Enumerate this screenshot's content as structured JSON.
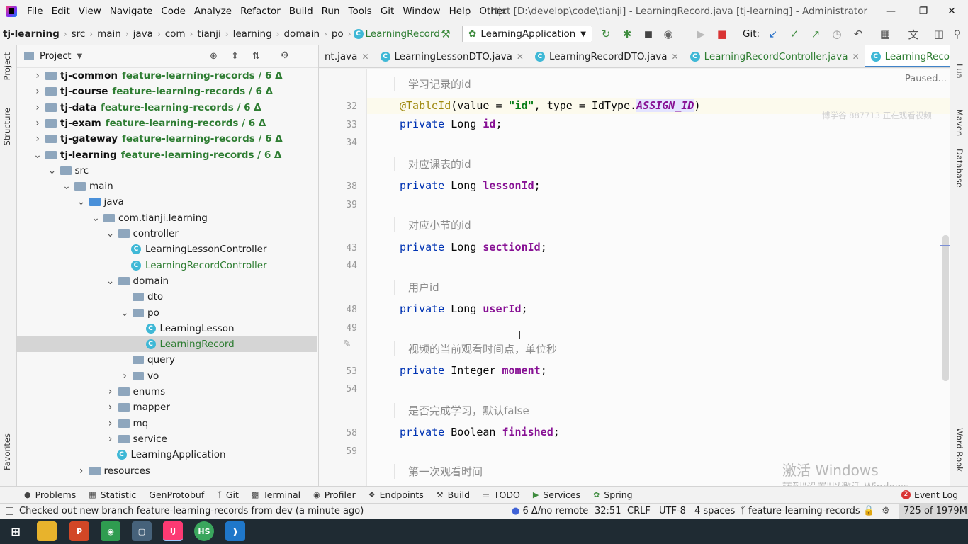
{
  "menu": [
    "File",
    "Edit",
    "View",
    "Navigate",
    "Code",
    "Analyze",
    "Refactor",
    "Build",
    "Run",
    "Tools",
    "Git",
    "Window",
    "Help",
    "Other"
  ],
  "window_title": "tjxt [D:\\develop\\code\\tianji] - LearningRecord.java [tj-learning] - Administrator",
  "breadcrumb": [
    "tj-learning",
    "src",
    "main",
    "java",
    "com",
    "tianji",
    "learning",
    "domain",
    "po",
    "LearningRecord"
  ],
  "run_config": "LearningApplication",
  "git_label": "Git:",
  "project_panel": {
    "title": "Project",
    "tree": [
      {
        "label": "tj-common",
        "branch": "feature-learning-records / 6 Δ",
        "kind": "module",
        "depth": 0,
        "expanded": false
      },
      {
        "label": "tj-course",
        "branch": "feature-learning-records / 6 Δ",
        "kind": "module",
        "depth": 0,
        "expanded": false
      },
      {
        "label": "tj-data",
        "branch": "feature-learning-records / 6 Δ",
        "kind": "module",
        "depth": 0,
        "expanded": false
      },
      {
        "label": "tj-exam",
        "branch": "feature-learning-records / 6 Δ",
        "kind": "module",
        "depth": 0,
        "expanded": false
      },
      {
        "label": "tj-gateway",
        "branch": "feature-learning-records / 6 Δ",
        "kind": "module",
        "depth": 0,
        "expanded": false
      },
      {
        "label": "tj-learning",
        "branch": "feature-learning-records / 6 Δ",
        "kind": "module",
        "depth": 0,
        "expanded": true
      },
      {
        "label": "src",
        "kind": "folder",
        "depth": 1,
        "expanded": true
      },
      {
        "label": "main",
        "kind": "folder",
        "depth": 2,
        "expanded": true
      },
      {
        "label": "java",
        "kind": "folder-blue",
        "depth": 3,
        "expanded": true
      },
      {
        "label": "com.tianji.learning",
        "kind": "folder",
        "depth": 4,
        "expanded": true
      },
      {
        "label": "controller",
        "kind": "folder",
        "depth": 5,
        "expanded": true
      },
      {
        "label": "LearningLessonController",
        "kind": "class",
        "depth": 6
      },
      {
        "label": "LearningRecordController",
        "kind": "class-green",
        "depth": 6
      },
      {
        "label": "domain",
        "kind": "folder",
        "depth": 5,
        "expanded": true
      },
      {
        "label": "dto",
        "kind": "folder",
        "depth": 6
      },
      {
        "label": "po",
        "kind": "folder",
        "depth": 6,
        "expanded": true
      },
      {
        "label": "LearningLesson",
        "kind": "class",
        "depth": 7
      },
      {
        "label": "LearningRecord",
        "kind": "class-green",
        "depth": 7,
        "selected": true
      },
      {
        "label": "query",
        "kind": "folder",
        "depth": 6
      },
      {
        "label": "vo",
        "kind": "folder",
        "depth": 6,
        "expanded": false
      },
      {
        "label": "enums",
        "kind": "folder",
        "depth": 5,
        "expanded": false
      },
      {
        "label": "mapper",
        "kind": "folder",
        "depth": 5,
        "expanded": false
      },
      {
        "label": "mq",
        "kind": "folder",
        "depth": 5,
        "expanded": false
      },
      {
        "label": "service",
        "kind": "folder",
        "depth": 5,
        "expanded": false
      },
      {
        "label": "LearningApplication",
        "kind": "class-app",
        "depth": 5
      },
      {
        "label": "resources",
        "kind": "folder",
        "depth": 3,
        "expanded": false
      }
    ]
  },
  "editor_tabs": [
    {
      "label": "nt.java",
      "active": false
    },
    {
      "label": "LearningLessonDTO.java",
      "active": false
    },
    {
      "label": "LearningRecordDTO.java",
      "active": false
    },
    {
      "label": "LearningRecordController.java",
      "active": false,
      "green": true
    },
    {
      "label": "LearningRecord.java",
      "active": true
    }
  ],
  "editor": {
    "paused": "Paused...",
    "overlay_text": "博学谷 887713 正在观看视频",
    "lines": [
      {
        "type": "doc",
        "text": "学习记录的id"
      },
      {
        "num": "32",
        "type": "code",
        "html_key": "l32"
      },
      {
        "num": "33",
        "type": "code",
        "kw": "private",
        "t": "Long",
        "fld": "id"
      },
      {
        "num": "34",
        "type": "blank"
      },
      {
        "type": "doc",
        "text": "对应课表的id"
      },
      {
        "num": "38",
        "type": "code",
        "kw": "private",
        "t": "Long",
        "fld": "lessonId"
      },
      {
        "num": "39",
        "type": "blank"
      },
      {
        "type": "doc",
        "text": "对应小节的id"
      },
      {
        "num": "43",
        "type": "code",
        "kw": "private",
        "t": "Long",
        "fld": "sectionId"
      },
      {
        "num": "44",
        "type": "blank"
      },
      {
        "type": "doc",
        "text": "用户id"
      },
      {
        "num": "48",
        "type": "code",
        "kw": "private",
        "t": "Long",
        "fld": "userId"
      },
      {
        "num": "49",
        "type": "blank"
      },
      {
        "type": "doc",
        "text": "视频的当前观看时间点，单位秒"
      },
      {
        "num": "53",
        "type": "code",
        "kw": "private",
        "t": "Integer",
        "fld": "moment"
      },
      {
        "num": "54",
        "type": "blank"
      },
      {
        "type": "doc",
        "text": "是否完成学习，默认false"
      },
      {
        "num": "58",
        "type": "code",
        "kw": "private",
        "t": "Boolean",
        "fld": "finished"
      },
      {
        "num": "59",
        "type": "blank"
      },
      {
        "type": "doc",
        "text": "第一次观看时间"
      }
    ],
    "l32": {
      "ann": "@TableId",
      "p1": "(value = ",
      "s": "\"id\"",
      "p2": ", type = IdType.",
      "it": "ASSIGN_ID",
      "p3": ")"
    }
  },
  "right_tools": [
    "Lua",
    "Maven",
    "Database",
    "Word Book"
  ],
  "left_tools": [
    "Project",
    "Structure",
    "Favorites"
  ],
  "tool_windows": [
    "Problems",
    "Statistic",
    "GenProtobuf",
    "Git",
    "Terminal",
    "Profiler",
    "Endpoints",
    "Build",
    "TODO",
    "Services",
    "Spring"
  ],
  "event_log": {
    "label": "Event Log",
    "count": "2"
  },
  "status": {
    "message": "Checked out new branch feature-learning-records from dev (a minute ago)",
    "vcs": "6 Δ/no remote",
    "position": "32:51",
    "line_sep": "CRLF",
    "encoding": "UTF-8",
    "indent": "4 spaces",
    "branch": "feature-learning-records",
    "memory": "725 of 1979M"
  },
  "watermark": {
    "line1": "激活 Windows",
    "line2": "转到\"设置\"以激活 Windows。"
  }
}
